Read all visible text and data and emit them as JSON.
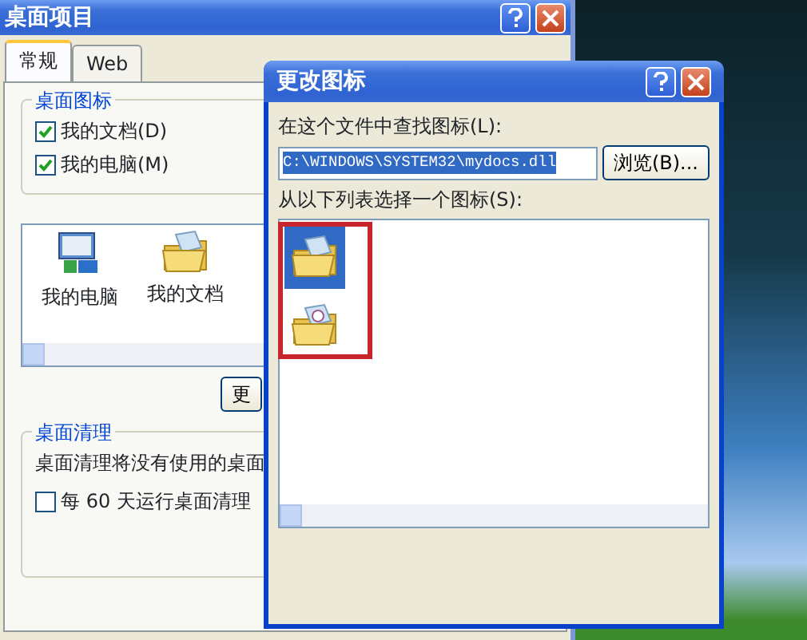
{
  "back_window": {
    "title": "桌面项目",
    "tabs": [
      {
        "label": "常规",
        "selected": true
      },
      {
        "label": "Web",
        "selected": false
      }
    ],
    "desktop_icons_group": {
      "title": "桌面图标",
      "checkboxes": [
        {
          "label": "我的文档(D)",
          "checked": true
        },
        {
          "label": "我的电脑(M)",
          "checked": true
        }
      ]
    },
    "icon_list": [
      {
        "kind": "computer",
        "label": "我的电脑"
      },
      {
        "kind": "documents",
        "label": "我的文档"
      }
    ],
    "change_icon_button": "更",
    "cleanup_group": {
      "title": "桌面清理",
      "description": "桌面清理将没有使用的桌面",
      "checkbox": {
        "label": "每 60 天运行桌面清理",
        "checked": false
      }
    }
  },
  "dialog": {
    "title": "更改图标",
    "file_label": "在这个文件中查找图标(L):",
    "file_value": "C:\\WINDOWS\\SYSTEM32\\mydocs.dll",
    "browse_button": "浏览(B)...",
    "list_label": "从以下列表选择一个图标(S):",
    "icons": [
      {
        "kind": "open-folder",
        "selected": true
      },
      {
        "kind": "folder-with-disc",
        "selected": false
      }
    ]
  }
}
